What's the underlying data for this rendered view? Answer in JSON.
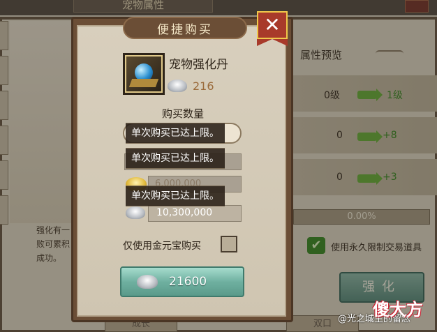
{
  "background": {
    "window_title": "宠物属性",
    "attr_header": "属性预览",
    "attr_rows": [
      {
        "current": "0级",
        "next": "1级"
      },
      {
        "current": "0",
        "next": "+8"
      },
      {
        "current": "0",
        "next": "+3"
      }
    ],
    "progress": "0.00%",
    "left_text": "强化有一定几率失败可累积成功几率直到成功。",
    "left_text_lines": [
      "强化有一",
      "败可累积",
      "成功。"
    ],
    "permanent_label": "使用永久限制交易道具",
    "enhance_label": "强化",
    "bottom_tabs": [
      "成长",
      "双口"
    ]
  },
  "dialog": {
    "title": "便捷购买",
    "item_name": "宠物强化丹",
    "item_price": "216",
    "qty_label": "购买数量",
    "toasts": [
      "单次购买已达上限。",
      "单次购买已达上限。",
      "单次购买已达上限。"
    ],
    "gold_amount": "6,000,000",
    "silver_amount": "10,300,000",
    "gold_only_label": "仅使用金元宝购买",
    "gold_only_checked": false,
    "buy_amount": "21600"
  },
  "watermark": {
    "text": "@光之城主的留念",
    "logo": "傻大方"
  },
  "colors": {
    "accent_green": "#6cae3e",
    "button_teal": "#6fb0a0",
    "close_red": "#a83a2a",
    "price_brown": "#9a6a3a"
  },
  "icons": [
    "close-icon",
    "silver-ingot-icon",
    "gold-ingot-icon",
    "check-icon",
    "arrow-right-icon"
  ]
}
